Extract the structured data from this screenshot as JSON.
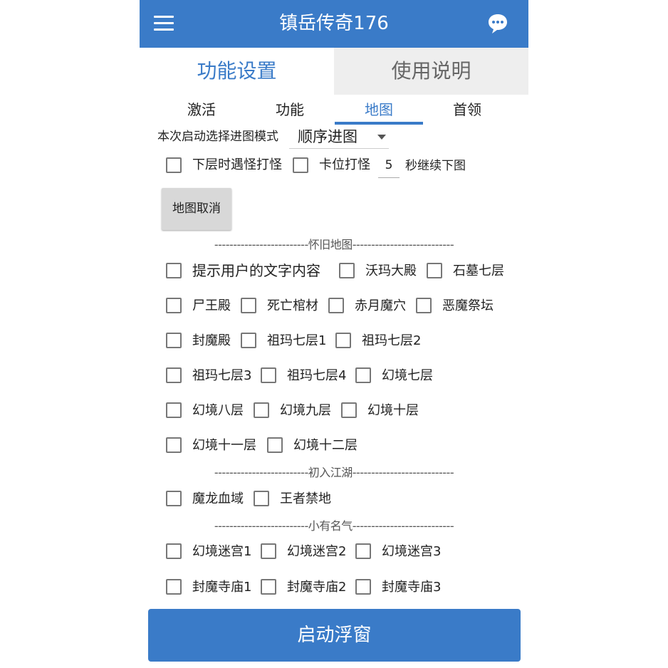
{
  "header": {
    "title": "镇岳传奇176",
    "menu_icon": "menu-icon",
    "chat_icon": "chat-icon"
  },
  "main_tabs": [
    {
      "label": "功能设置",
      "active": true
    },
    {
      "label": "使用说明",
      "active": false
    }
  ],
  "sub_tabs": [
    {
      "label": "激活",
      "active": false
    },
    {
      "label": "功能",
      "active": false
    },
    {
      "label": "地图",
      "active": true
    },
    {
      "label": "首领",
      "active": false
    }
  ],
  "mode": {
    "label": "本次启动选择进图模式",
    "selected": "顺序进图"
  },
  "options_row": {
    "opt1": "下层时遇怪打怪",
    "opt2": "卡位打怪",
    "seconds_value": "5",
    "seconds_label": "秒继续下图"
  },
  "cancel_button": "地图取消",
  "sections": {
    "nostalgic": {
      "title": "-------------------------怀旧地图---------------------------",
      "rows": [
        [
          "提示用户的文字内容",
          "沃玛大殿",
          "石墓七层"
        ],
        [
          "尸王殿",
          "死亡棺材",
          "赤月魔穴",
          "恶魔祭坛"
        ],
        [
          "封魔殿",
          "祖玛七层1",
          "祖玛七层2"
        ],
        [
          "祖玛七层3",
          "祖玛七层4",
          "幻境七层"
        ],
        [
          "幻境八层",
          "幻境九层",
          "幻境十层"
        ],
        [
          "幻境十一层",
          "幻境十二层"
        ]
      ]
    },
    "novice": {
      "title": "-------------------------初入江湖---------------------------",
      "rows": [
        [
          "魔龙血域",
          "王者禁地"
        ]
      ]
    },
    "famous": {
      "title": "-------------------------小有名气---------------------------",
      "rows": [
        [
          "幻境迷宫1",
          "幻境迷宫2",
          "幻境迷宫3"
        ],
        [
          "封魔寺庙1",
          "封魔寺庙2",
          "封魔寺庙3"
        ]
      ]
    }
  },
  "launch_button": "启动浮窗",
  "colors": {
    "accent": "#3a7bc8",
    "inactive_tab_bg": "#eeeeee",
    "button_gray": "#d8d8d8"
  }
}
